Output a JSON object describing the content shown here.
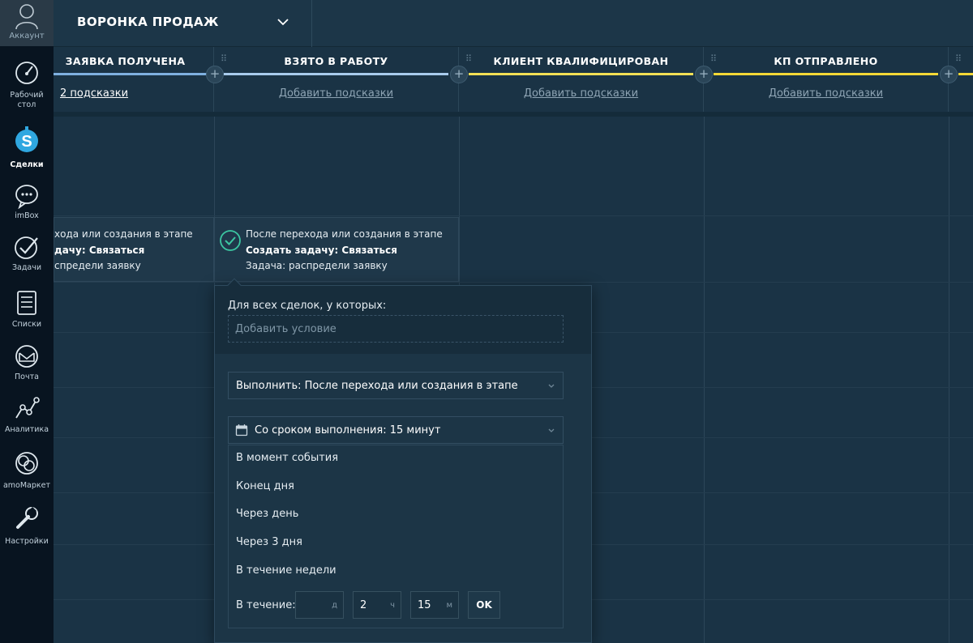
{
  "nav": {
    "account": "Аккаунт",
    "items": [
      {
        "label": "Рабочий\nстол",
        "icon": "dashboard-icon"
      },
      {
        "label": "Сделки",
        "icon": "deals-icon",
        "active": true
      },
      {
        "label": "imBox",
        "icon": "chat-icon"
      },
      {
        "label": "Задачи",
        "icon": "tasks-icon"
      },
      {
        "label": "Списки",
        "icon": "lists-icon"
      },
      {
        "label": "Почта",
        "icon": "mail-icon"
      },
      {
        "label": "Аналитика",
        "icon": "analytics-icon"
      },
      {
        "label": "amoМаркет",
        "icon": "market-icon"
      },
      {
        "label": "Настройки",
        "icon": "settings-icon"
      }
    ]
  },
  "header": {
    "pipeline_title": "ВОРОНКА ПРОДАЖ"
  },
  "stages": [
    {
      "title": "ЗАЯВКА ПОЛУЧЕНА",
      "color": "#7fb0e0",
      "hint": "2 подсказки"
    },
    {
      "title": "ВЗЯТО В РАБОТУ",
      "color": "#a8cbec",
      "hint": "Добавить подсказки"
    },
    {
      "title": "КЛИЕНТ КВАЛИФИЦИРОВАН",
      "color": "#f2e055",
      "hint": "Добавить подсказки"
    },
    {
      "title": "КП ОТПРАВЛЕНО",
      "color": "#f5d836",
      "hint": "Добавить подсказки"
    }
  ],
  "cards": [
    {
      "line1": "хода или создания в этапе",
      "line2": "дачу: Связаться",
      "line3": "спредели заявку"
    },
    {
      "line1": "После перехода или создания в этапе",
      "line2": "Создать задачу: Связаться",
      "line3": "Задача: распредели заявку"
    }
  ],
  "popup": {
    "condition_label": "Для всех сделок, у которых:",
    "condition_placeholder": "Добавить условие",
    "execute_value": "Выполнить: После перехода или создания в этапе",
    "deadline_value": "Со сроком выполнения: 15 минут",
    "options": [
      "В момент события",
      "Конец дня",
      "Через день",
      "Через 3 дня",
      "В течение недели"
    ],
    "within_label": "В течение:",
    "days_value": "",
    "days_unit": "д",
    "hours_value": "2",
    "hours_unit": "ч",
    "minutes_value": "15",
    "minutes_unit": "м",
    "ok_label": "OK"
  }
}
